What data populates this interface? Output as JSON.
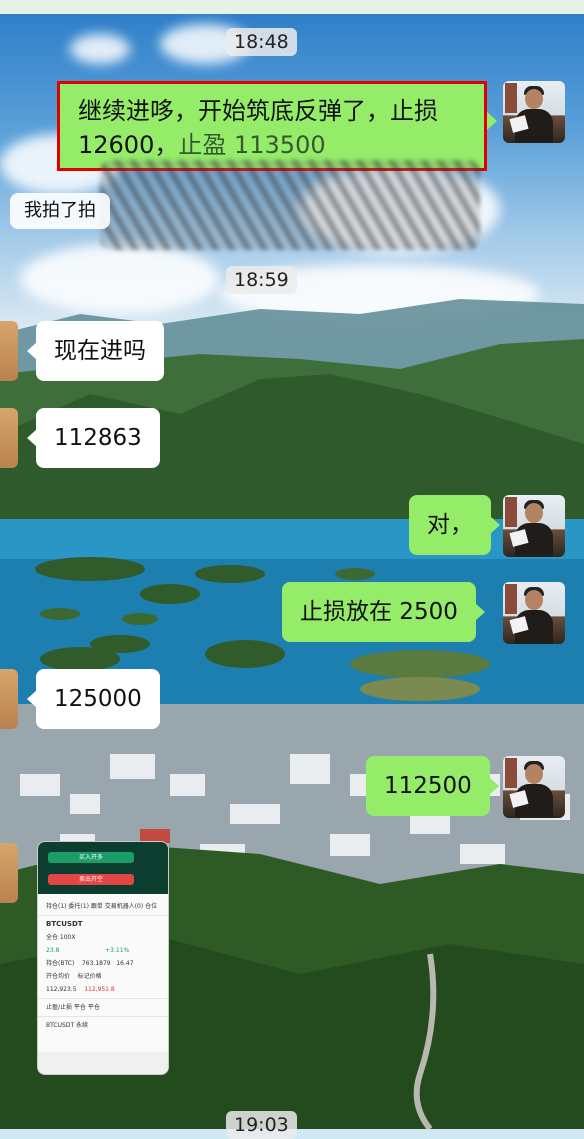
{
  "chat": {
    "timestamps": [
      "18:48",
      "18:59",
      "19:03"
    ],
    "messages": [
      {
        "side": "right",
        "text_line1": "继续进哆，开始筑底反弹了，止损",
        "text_line2_a": "12600，",
        "text_line2_b": "止盈 113500",
        "highlighted": true
      },
      {
        "side": "left",
        "text": "我拍了拍"
      },
      {
        "side": "left",
        "text": "现在进吗"
      },
      {
        "side": "left",
        "text": "112863"
      },
      {
        "side": "right",
        "text": "对，"
      },
      {
        "side": "right",
        "text": "止损放在 2500"
      },
      {
        "side": "left",
        "text": "125000"
      },
      {
        "side": "right",
        "text": "112500"
      }
    ]
  },
  "screenshot": {
    "buy_label": "买入开多",
    "sell_label": "卖出开空",
    "tabs": "持仓(1)  委托(1)  跟单  交易机器人(0)  仓位",
    "symbol": "BTCUSDT",
    "leverage": "全仓 100X",
    "pnl": "23.8",
    "pnl_pct": "+3.11%",
    "size_label": "持仓(BTC)",
    "size_value": "763.1879",
    "entry_label": "开仓均价",
    "entry_value": "112,923.5",
    "mark_label": "标记价格",
    "mark_value": "112,951.8",
    "liq_value": "16.47",
    "buttons": "止盈/止损    平仓    平仓",
    "footer": "BTCUSDT 永续"
  },
  "colors": {
    "green_bubble": "#95ec69",
    "highlight_border": "#e00000",
    "bubble_white": "#ffffff"
  }
}
